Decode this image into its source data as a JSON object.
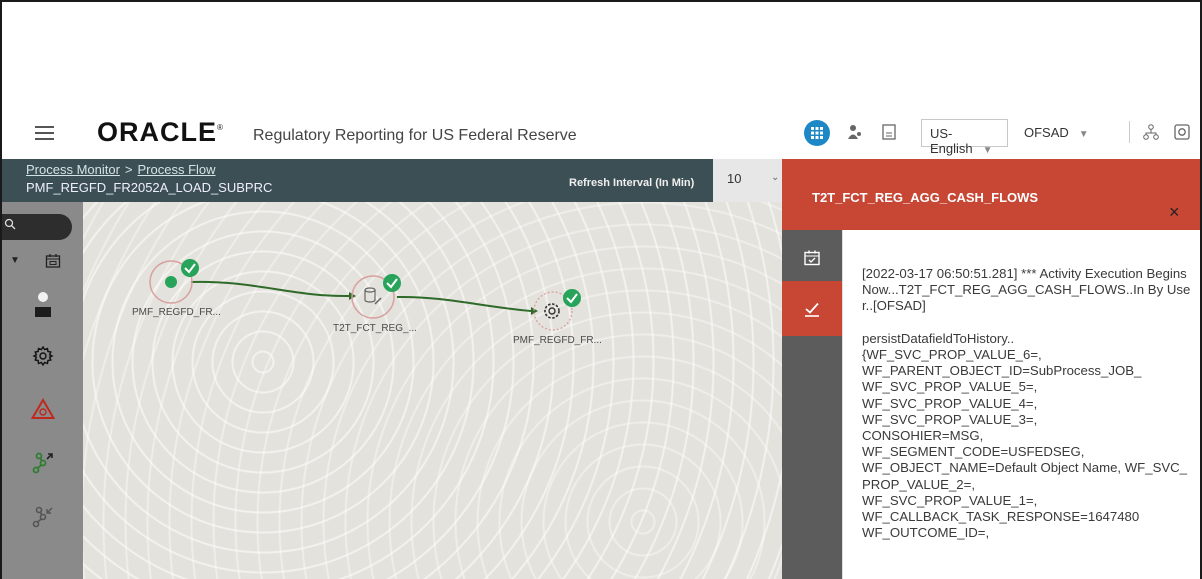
{
  "header": {
    "brand": "ORACLE",
    "brand_mark": "®",
    "app_title": "Regulatory Reporting for US Federal Reserve",
    "language": "US-English",
    "user": "OFSAD",
    "icons": [
      "menu-icon",
      "grid-apps-icon",
      "user-group-icon",
      "document-icon",
      "network-icon",
      "help-icon"
    ]
  },
  "breadcrumb": {
    "items": [
      "Process Monitor",
      "Process Flow"
    ],
    "separator": ">",
    "process_name": "PMF_REGFD_FR2052A_LOAD_SUBPRC"
  },
  "refresh": {
    "label": "Refresh Interval (In Min)",
    "value": "10"
  },
  "sidebar": {
    "icons": [
      "search-icon",
      "calendar-icon",
      "user-icon",
      "settings-icon",
      "warning-settings-icon",
      "flow-expand-icon",
      "flow-collapse-icon"
    ]
  },
  "flow": {
    "nodes": [
      {
        "label": "PMF_REGFD_FR...",
        "type": "start",
        "status": "completed"
      },
      {
        "label": "T2T_FCT_REG_...",
        "type": "task",
        "status": "completed"
      },
      {
        "label": "PMF_REGFD_FR...",
        "type": "process",
        "status": "completed"
      }
    ]
  },
  "panel": {
    "title": "T2T_FCT_REG_AGG_CASH_FLOWS",
    "close": "×",
    "tabs": [
      "calendar-icon",
      "check-icon"
    ],
    "log": "[2022-03-17 06:50:51.281] *** Activity Execution Begins Now...T2T_FCT_REG_AGG_CASH_FLOWS..In By User..[OFSAD]\n\npersistDatafieldToHistory..\n{WF_SVC_PROP_VALUE_6=,\nWF_PARENT_OBJECT_ID=SubProcess_JOB_\nWF_SVC_PROP_VALUE_5=,\nWF_SVC_PROP_VALUE_4=,\nWF_SVC_PROP_VALUE_3=,\nCONSOHIER=MSG,\nWF_SEGMENT_CODE=USFEDSEG,\nWF_OBJECT_NAME=Default Object Name, WF_SVC_PROP_VALUE_2=,\nWF_SVC_PROP_VALUE_1=,\nWF_CALLBACK_TASK_RESPONSE=1647480\nWF_OUTCOME_ID=,"
  },
  "colors": {
    "accent": "#c74634",
    "header_bar": "#3c4f54",
    "success": "#3aa35c",
    "link_blue": "#1e88c7"
  }
}
